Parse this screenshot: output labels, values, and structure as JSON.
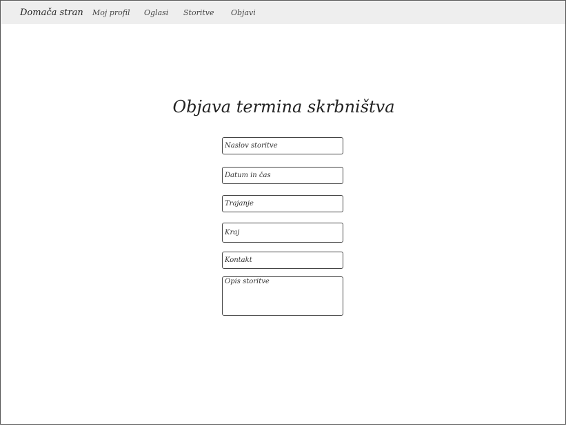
{
  "navbar": {
    "brand": "Domača stran",
    "links": [
      {
        "label": "Moj profil"
      },
      {
        "label": "Oglasi"
      },
      {
        "label": "Storitve"
      },
      {
        "label": "Objavi"
      }
    ]
  },
  "main": {
    "title": "Objava termina skrbništva",
    "form": {
      "naslov": {
        "placeholder": "Naslov storitve",
        "value": ""
      },
      "datum": {
        "placeholder": "Datum in čas",
        "value": ""
      },
      "trajanje": {
        "placeholder": "Trajanje",
        "value": ""
      },
      "kraj": {
        "placeholder": "Kraj",
        "value": ""
      },
      "kontakt": {
        "placeholder": "Kontakt",
        "value": ""
      },
      "opis": {
        "placeholder": "Opis storitve",
        "value": ""
      }
    }
  },
  "colors": {
    "navbar_bg": "#eeeeee",
    "border": "#444444",
    "text": "#222222"
  }
}
